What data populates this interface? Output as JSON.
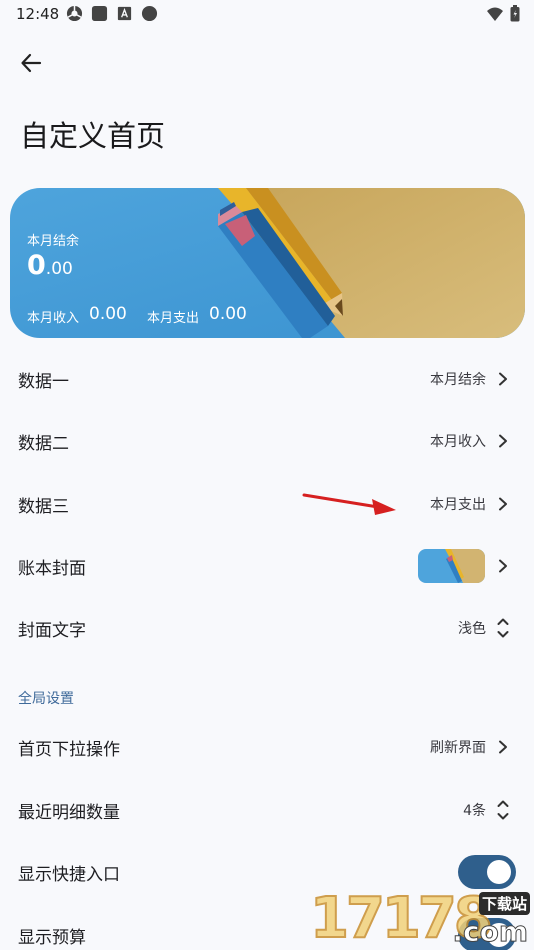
{
  "status_bar": {
    "time": "12:48"
  },
  "header": {
    "title": "自定义首页"
  },
  "cover_card": {
    "balance_label": "本月结余",
    "balance_int": "0",
    "balance_dec": ".00",
    "income_label": "本月收入",
    "income_value": "0.00",
    "expense_label": "本月支出",
    "expense_value": "0.00"
  },
  "rows": {
    "data1": {
      "label": "数据一",
      "value": "本月结余"
    },
    "data2": {
      "label": "数据二",
      "value": "本月收入"
    },
    "data3": {
      "label": "数据三",
      "value": "本月支出"
    },
    "cover": {
      "label": "账本封面"
    },
    "cover_text": {
      "label": "封面文字",
      "value": "浅色"
    }
  },
  "global_section": {
    "header": "全局设置",
    "pull_action": {
      "label": "首页下拉操作",
      "value": "刷新界面"
    },
    "recent_count": {
      "label": "最近明细数量",
      "value": "4条"
    },
    "show_shortcut": {
      "label": "显示快捷入口",
      "on": true
    },
    "show_budget": {
      "label": "显示预算",
      "on": true
    }
  },
  "watermark": {
    "digits": "17178",
    "com": ".com",
    "site": "下载站"
  },
  "colors": {
    "accent": "#2f5f8c",
    "section_header": "#3f6a9a",
    "background": "#f8f9fc",
    "arrow": "#d62020"
  }
}
